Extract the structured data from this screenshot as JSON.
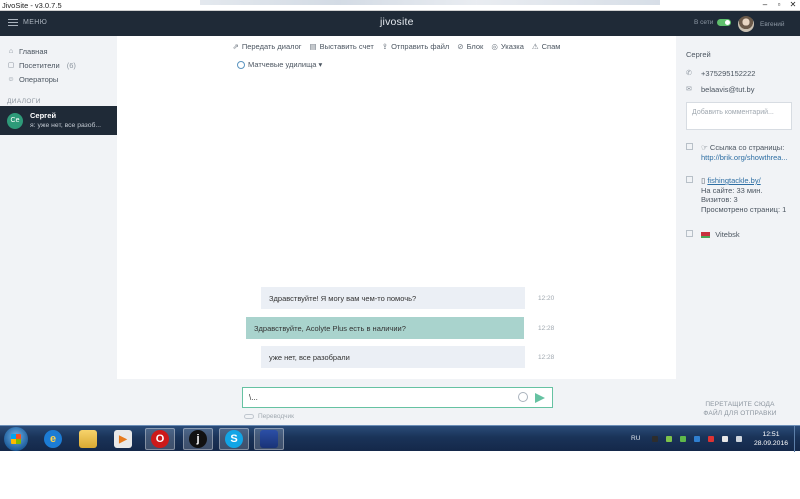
{
  "window": {
    "title": "JivoSite - v3.0.7.5",
    "btn_min": "–",
    "btn_max": "▫",
    "btn_close": "✕"
  },
  "header": {
    "menu_label": "МЕНЮ",
    "logo": "jivosite",
    "status_label": "В сети",
    "agent_name": "Евгений"
  },
  "sidebar": {
    "nav": [
      {
        "label": "Главная",
        "icon": "home-icon",
        "count": ""
      },
      {
        "label": "Посетители",
        "icon": "visitors-icon",
        "count": "(6)"
      },
      {
        "label": "Операторы",
        "icon": "operators-icon",
        "count": ""
      }
    ],
    "section_title": "ДИАЛОГИ",
    "chat": {
      "initials": "Се",
      "name": "Сергей",
      "preview": "я: уже нет, все разоб..."
    }
  },
  "toolbar": {
    "items": [
      {
        "label": "Передать диалог",
        "glyph": "⇗",
        "icon": "transfer-icon"
      },
      {
        "label": "Выставить счет",
        "glyph": "▤",
        "icon": "invoice-icon"
      },
      {
        "label": "Отправить файл",
        "glyph": "⇪",
        "icon": "upload-icon"
      },
      {
        "label": "Блок",
        "glyph": "⊘",
        "icon": "block-icon"
      },
      {
        "label": "Указка",
        "glyph": "◎",
        "icon": "pointer-icon"
      },
      {
        "label": "Спам",
        "glyph": "⚠",
        "icon": "spam-icon"
      }
    ]
  },
  "source_page": "Матчевые удилища ▾",
  "messages": [
    {
      "text": "Здравствуйте! Я могу вам чем-то помочь?",
      "time": "12:20",
      "from": "operator"
    },
    {
      "text": "Здравствуйте, Acolyte Plus есть в наличии?",
      "time": "12:28",
      "from": "client"
    },
    {
      "text": "уже нет, все разобрали",
      "time": "12:28",
      "from": "operator"
    }
  ],
  "input": {
    "value": "\\..."
  },
  "translator_label": "Переводчик",
  "right_panel": {
    "name": "Сергей",
    "phone": "+375295152222",
    "email": "belaavis@tut.by",
    "comment_placeholder": "Добавить комментарий...",
    "page_link_label": "Ссылка со страницы:",
    "page_link_url": "http://brik.org/showthrea...",
    "site": "fishingtackle.by/",
    "on_site": "На сайте: 33 мин.",
    "visits": "Визитов: 3",
    "pages_viewed": "Просмотрено страниц: 1",
    "city": "Vitebsk",
    "dropzone": "ПЕРЕТАЩИТЕ СЮДА ФАЙЛ ДЛЯ ОТПРАВКИ"
  },
  "taskbar": {
    "lang": "RU",
    "time": "12:51",
    "date": "28.09.2016"
  },
  "colors": {
    "header_bg": "#1f2a37",
    "accent": "#66c2a2",
    "client_bubble": "#a9d3cd",
    "operator_bubble": "#ebeff5",
    "panel_bg": "#f1f3f6"
  }
}
